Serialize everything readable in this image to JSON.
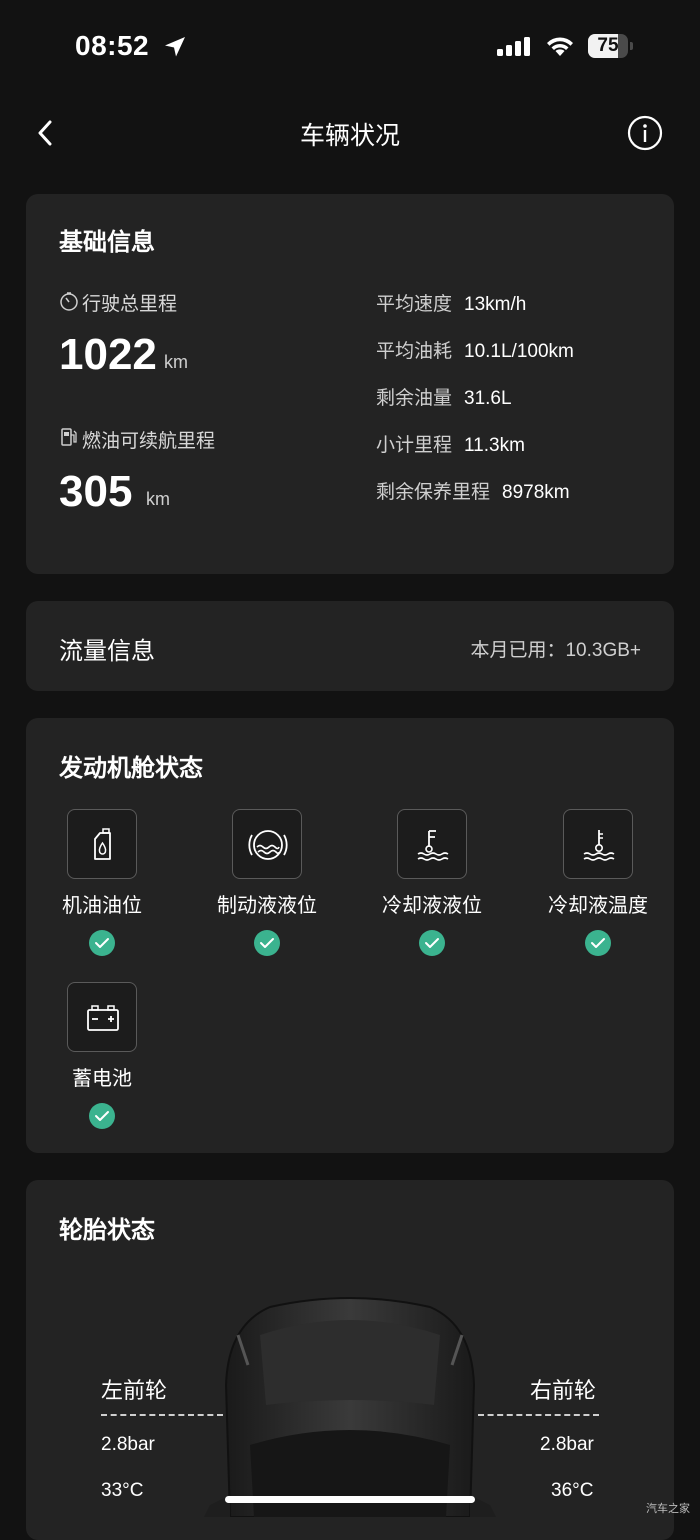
{
  "status_bar": {
    "time": "08:52",
    "battery_percent": "75",
    "battery_level": 0.75
  },
  "nav": {
    "title": "车辆状况"
  },
  "basic_info": {
    "title": "基础信息",
    "total_mileage_label": "行驶总里程",
    "total_mileage_value": "1022",
    "total_mileage_unit": "km",
    "range_label": "燃油可续航里程",
    "range_value": "305",
    "range_unit": "km",
    "stats": [
      {
        "label": "平均速度",
        "value": "13km/h"
      },
      {
        "label": "平均油耗",
        "value": "10.1L/100km"
      },
      {
        "label": "剩余油量",
        "value": "31.6L"
      },
      {
        "label": "小计里程",
        "value": "11.3km"
      },
      {
        "label": "剩余保养里程",
        "value": "8978km"
      }
    ]
  },
  "flow_info": {
    "title": "流量信息",
    "usage": "本月已用：10.3GB+"
  },
  "engine": {
    "title": "发动机舱状态",
    "items": [
      {
        "label": "机油油位",
        "icon": "oil-bottle-icon",
        "status": "ok"
      },
      {
        "label": "制动液液位",
        "icon": "brake-fluid-icon",
        "status": "ok"
      },
      {
        "label": "冷却液液位",
        "icon": "coolant-level-icon",
        "status": "ok"
      },
      {
        "label": "冷却液温度",
        "icon": "coolant-temp-icon",
        "status": "ok"
      },
      {
        "label": "蓄电池",
        "icon": "battery-icon",
        "status": "ok"
      }
    ]
  },
  "tires": {
    "title": "轮胎状态",
    "front_left": {
      "label": "左前轮",
      "pressure": "2.8bar",
      "temp": "33°C"
    },
    "front_right": {
      "label": "右前轮",
      "pressure": "2.8bar",
      "temp": "36°C"
    }
  },
  "watermark": "汽车之家",
  "colors": {
    "background": "#121212",
    "card": "#232323",
    "ok_green": "#3bb38f"
  }
}
